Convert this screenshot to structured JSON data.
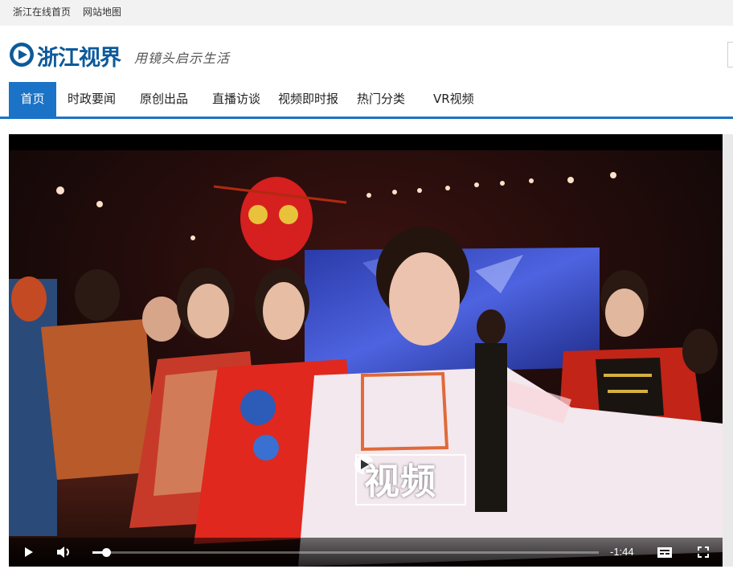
{
  "topbar": {
    "home_label": "浙江在线首页",
    "sitemap_label": "网站地图"
  },
  "header": {
    "logo_text": "浙江视界",
    "slogan": "用镜头启示生活",
    "brand_color": "#0c5a9b"
  },
  "nav": {
    "accent_color": "#1a73c6",
    "items": [
      {
        "label": "首页",
        "active": true
      },
      {
        "label": "时政要闻"
      },
      {
        "label": "原创出品"
      },
      {
        "label": "直播访谈"
      },
      {
        "label": "视频即时报"
      },
      {
        "label": "热门分类"
      },
      {
        "label": "VR视频"
      }
    ]
  },
  "video": {
    "watermark_text": "视频",
    "time_remaining": "-1:44",
    "progress": 0.027,
    "controls": {
      "play_icon": "play-icon",
      "volume_icon": "volume-icon",
      "captions_icon": "captions-icon",
      "fullscreen_icon": "fullscreen-icon"
    }
  }
}
